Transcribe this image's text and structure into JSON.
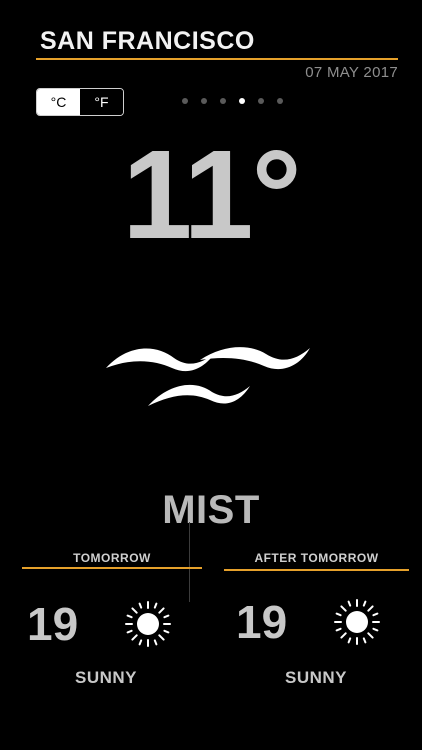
{
  "location": {
    "city": "SAN FRANCISCO",
    "date": "07 MAY 2017"
  },
  "units": {
    "celsius_label": "°C",
    "fahrenheit_label": "°F",
    "selected": "celsius"
  },
  "pager": {
    "total": 6,
    "active_index": 3
  },
  "current": {
    "temperature": "11°",
    "condition": "MIST",
    "icon": "mist-icon"
  },
  "forecast": [
    {
      "day_label": "TOMORROW",
      "temperature": "19",
      "condition": "SUNNY",
      "icon": "sun-icon"
    },
    {
      "day_label": "AFTER TOMORROW",
      "temperature": "19",
      "condition": "SUNNY",
      "icon": "sun-icon"
    }
  ],
  "colors": {
    "accent": "#e6a12b",
    "background": "#000000",
    "text_primary": "#c8c8c8"
  }
}
